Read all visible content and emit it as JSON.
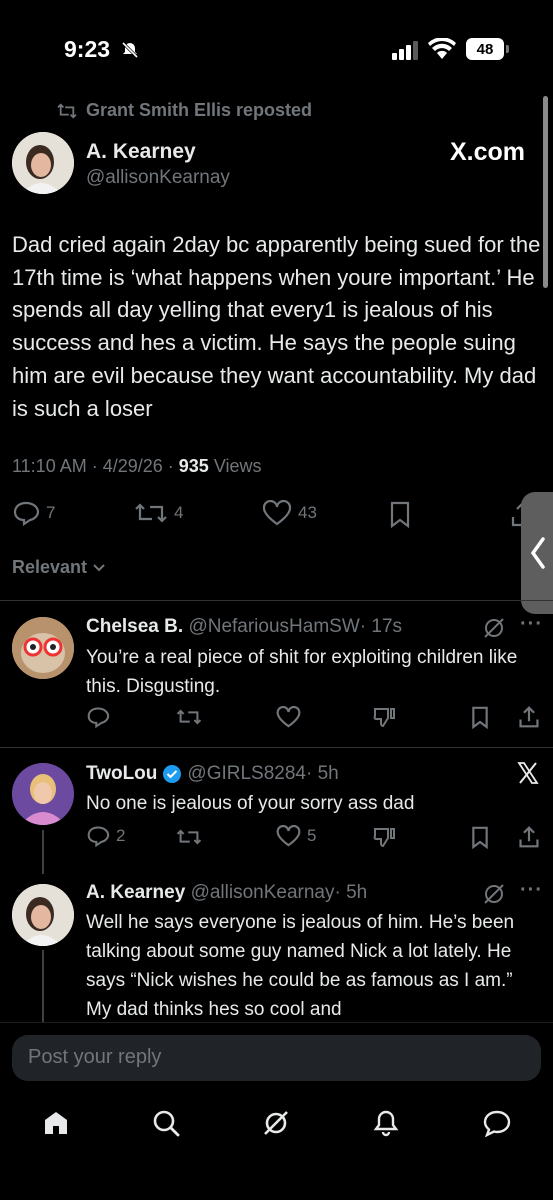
{
  "status_bar": {
    "time": "9:23",
    "battery": "48"
  },
  "repost": {
    "text": "Grant Smith Ellis reposted"
  },
  "tweet": {
    "author_name": "A. Kearney",
    "handle": "@allisonKearnay",
    "watermark": "X.com",
    "body": "Dad cried again 2day bc apparently being sued for the 17th time is ‘what happens when youre important.’ He spends all day yelling that every1 is jealous of his success and hes a victim. He says the people suing him are evil because they want accountability. My dad is such a loser",
    "time": "11:10 AM · 4/29/26 · ",
    "views_count": "935",
    "views_label": " Views",
    "replies": "7",
    "reposts": "4",
    "likes": "43"
  },
  "sort": {
    "label": "Relevant"
  },
  "replies": [
    {
      "name": "Chelsea B.",
      "handle": "@NefariousHamSW",
      "time": "· 17s",
      "text": "You’re a real piece of shit for exploiting children like this. Disgusting."
    },
    {
      "name": "TwoLou",
      "handle": "@GIRLS8284",
      "time": "· 5h",
      "text": "No one is jealous of your sorry ass dad",
      "replies": "2",
      "likes": "5"
    },
    {
      "name": "A. Kearney",
      "handle": "@allisonKearnay",
      "time": "· 5h",
      "text": "Well he says everyone is jealous of him. He’s been talking about some guy named Nick a lot lately. He says “Nick wishes he could be as famous as I am.” My dad thinks hes so cool and"
    }
  ],
  "composer": {
    "placeholder": "Post your reply"
  },
  "colors": {
    "background": "#000000",
    "text": "#e7e9ea",
    "muted": "#71767b",
    "verified": "#1d9bf0"
  },
  "icons": [
    "repost-icon",
    "reply-icon",
    "like-icon",
    "bookmark-icon",
    "share-icon",
    "grok-icon",
    "more-icon",
    "x-logo-icon",
    "home-icon",
    "search-icon",
    "bell-icon",
    "messages-icon",
    "verified-icon"
  ]
}
